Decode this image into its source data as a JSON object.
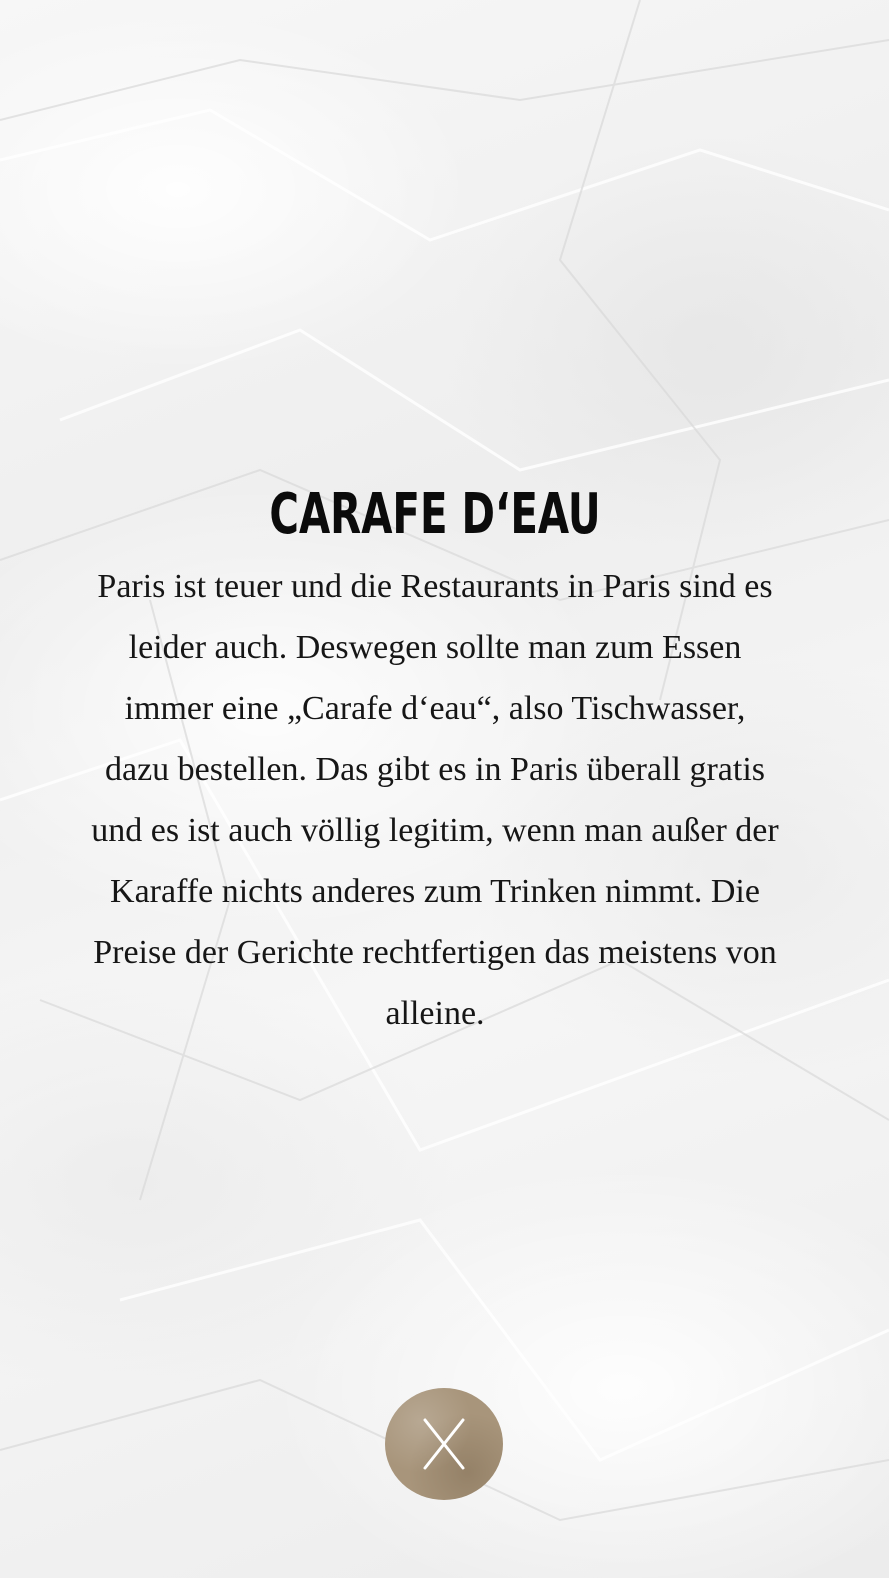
{
  "modal": {
    "title": "CARAFE D‘EAU",
    "body": "Paris ist teuer und die Restaurants in Paris sind es leider auch. Deswegen sollte man zum Essen immer eine „Carafe d‘eau“, also Tischwasser, dazu bestellen. Das gibt es in Paris überall gratis und es ist auch völlig legitim, wenn man außer der Karaffe nichts anderes zum Trinken nimmt. Die Preise der Gerichte rechtfertigen das meistens von alleine."
  },
  "close_button": {
    "icon": "close-icon",
    "color": "#a8957b"
  },
  "colors": {
    "background": "#f3f3f3",
    "text": "#111111"
  }
}
